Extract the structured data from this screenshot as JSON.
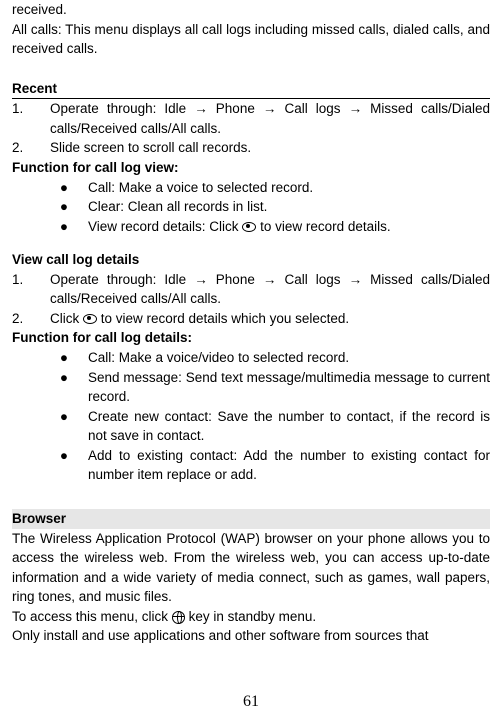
{
  "intro": {
    "fragment_top": "received.",
    "all_calls": "All calls: This menu displays all call logs including missed calls, dialed calls, and received calls."
  },
  "recent": {
    "heading": "Recent",
    "steps": [
      {
        "num": "1.",
        "text_before": "Operate through: Idle ",
        "text_after": " Missed calls/Dialed calls/Received calls/All calls.",
        "path": [
          "Phone",
          "Call logs"
        ]
      },
      {
        "num": "2.",
        "text": "Slide screen to scroll call records."
      }
    ],
    "func_heading": "Function for call log view:",
    "bullets": [
      "Call: Make a voice to selected record.",
      "Clear: Clean all records in list.",
      {
        "pre": "View record details: Click ",
        "post": " to view record details."
      }
    ]
  },
  "view_details": {
    "heading": "View call log details",
    "steps": [
      {
        "num": "1.",
        "text_before": "Operate through: Idle ",
        "text_after": " Missed calls/Dialed calls/Received calls/All calls.",
        "path": [
          "Phone",
          "Call logs"
        ]
      },
      {
        "num": "2.",
        "pre": "Click ",
        "post": " to view record details which you selected."
      }
    ],
    "func_heading": "Function for call log details:",
    "bullets": [
      "Call: Make a voice/video to selected record.",
      "Send message: Send text message/multimedia message to current record.",
      "Create new contact: Save the number to contact, if the record is not save in contact.",
      "Add to existing contact: Add the number to existing contact for number item replace or add."
    ]
  },
  "browser": {
    "heading": "Browser",
    "p1": "The Wireless Application Protocol (WAP) browser on your phone allows you to access the wireless web. From the wireless web, you can access up-to-date information and a wide variety of media connect, such as games, wall papers, ring tones, and music files.",
    "p2_pre": "To access this menu, click ",
    "p2_post": " key in standby menu.",
    "p3": "Only install and use applications and other software from sources that"
  },
  "page_number": "61",
  "glyphs": {
    "arrow": "→",
    "bullet": "●"
  }
}
